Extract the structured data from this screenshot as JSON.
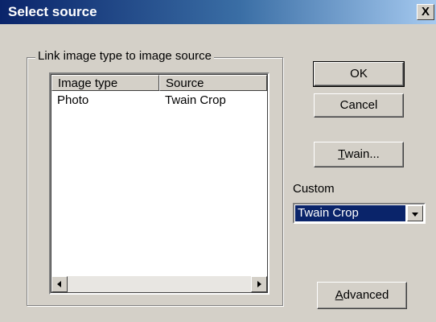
{
  "window": {
    "title": "Select source",
    "close_label": "X"
  },
  "group": {
    "label": "Link image type to image source"
  },
  "list": {
    "columns": [
      "Image type",
      "Source"
    ],
    "rows": [
      {
        "image_type": "Photo",
        "source": "Twain Crop"
      }
    ]
  },
  "buttons": {
    "ok": "OK",
    "cancel": "Cancel",
    "twain_mnemonic": "T",
    "twain_rest": "wain...",
    "advanced_mnemonic": "A",
    "advanced_rest": "dvanced"
  },
  "custom": {
    "label": "Custom",
    "selected": "Twain Crop"
  },
  "icons": {
    "close": "close-icon",
    "scroll_left": "arrow-left-icon",
    "scroll_right": "arrow-right-icon",
    "combo_dropdown": "chevron-down-icon"
  },
  "colors": {
    "title_bar_start": "#0a246a",
    "title_bar_end": "#a6caf0",
    "dialog_face": "#d4d0c8",
    "selection": "#0a246a"
  }
}
